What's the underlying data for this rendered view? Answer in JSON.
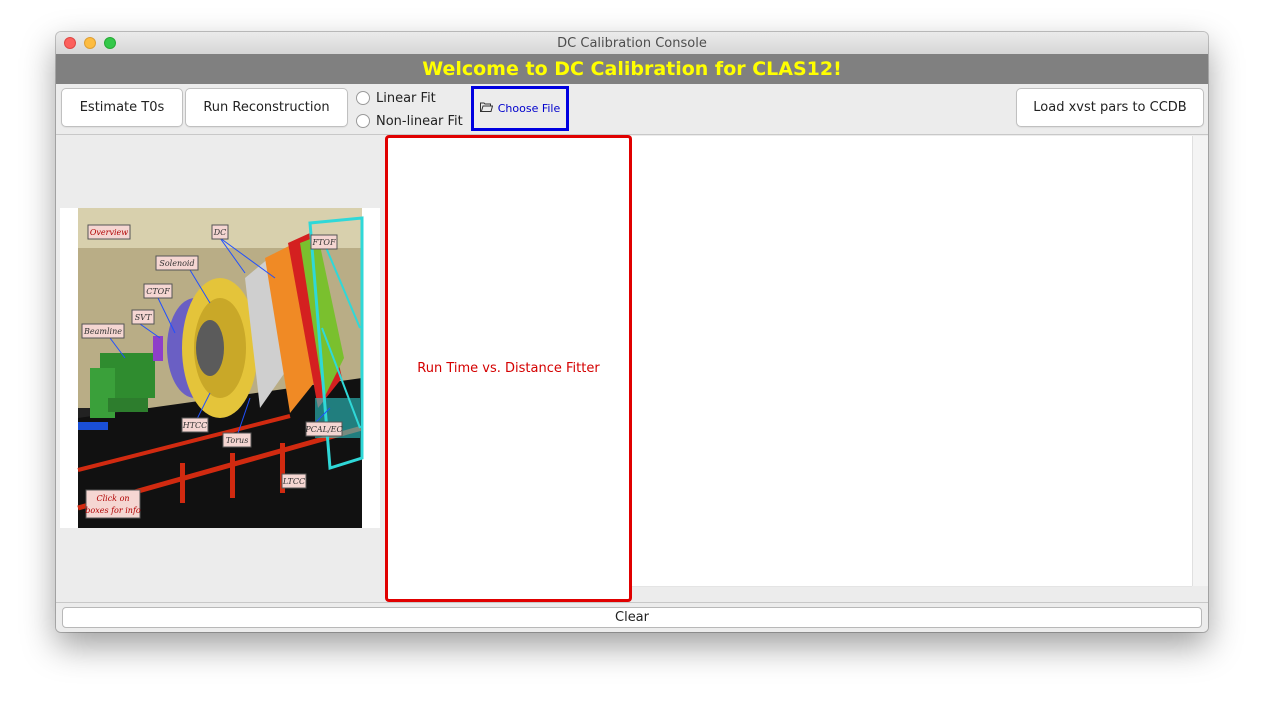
{
  "window": {
    "title": "DC Calibration Console"
  },
  "banner": {
    "text": "Welcome to DC Calibration for CLAS12!"
  },
  "toolbar": {
    "estimate_t0s": "Estimate T0s",
    "run_reconstruction": "Run Reconstruction",
    "fit_options": [
      {
        "label": "Linear Fit",
        "selected": false
      },
      {
        "label": "Non-linear Fit",
        "selected": false
      }
    ],
    "choose_file": "Choose File",
    "load_pars": "Load xvst pars to CCDB"
  },
  "main": {
    "fitter_button": "Run Time vs. Distance Fitter",
    "detector_image": {
      "labels": {
        "overview": "Overview",
        "dc": "DC",
        "ftof": "FTOF",
        "solenoid": "Solenoid",
        "ctof": "CTOF",
        "svt": "SVT",
        "beamline": "Beamline",
        "htcc": "HTCC",
        "torus": "Torus",
        "pcal_ec": "PCAL/EC",
        "ltcc": "LTCC",
        "click_line1": "Click on",
        "click_line2": "boxes for info"
      }
    }
  },
  "bottom": {
    "clear": "Clear"
  },
  "colors": {
    "banner_bg": "#808080",
    "banner_text": "#ffff00",
    "fitter_border": "#e00000",
    "choose_file_border": "#0000e0"
  }
}
